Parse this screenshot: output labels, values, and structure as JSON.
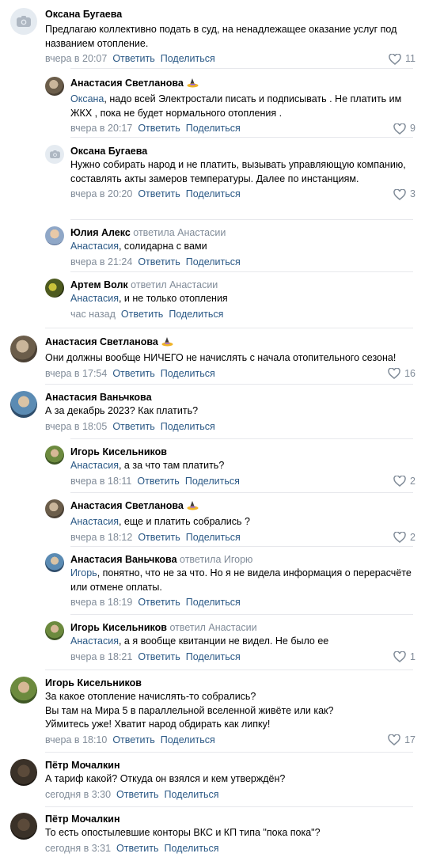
{
  "colors": {
    "link": "#2a5885",
    "meta": "#818c99",
    "separator": "#e7e8ec"
  },
  "labels": {
    "reply": "Ответить",
    "share": "Поделиться"
  },
  "comments": [
    {
      "name": "Оксана Бугаева",
      "avatar": "camera-icon",
      "text": "Предлагаю коллективно подать в суд, на ненадлежащее оказание услуг под названием отопление.",
      "time": "вчера в 20:07",
      "likes": "11"
    },
    {
      "name": "Анастасия Светланова",
      "avatar": "photo",
      "emoji": "witch-hat-emoji",
      "mention": "Оксана",
      "text": ", надо всей Электростали писать и подписывать . Не платить им ЖКХ , пока не будет нормального отопления .",
      "time": "вчера в 20:17",
      "likes": "9"
    },
    {
      "name": "Оксана Бугаева",
      "avatar": "camera-icon",
      "text": "Нужно собирать народ и не платить, вызывать управляющую компанию, составлять акты замеров температуры. Далее по инстанциям.",
      "time": "вчера в 20:20",
      "likes": "3"
    },
    {
      "name": "Юлия Алекс",
      "answered": "ответила Анастасии",
      "avatar": "photo",
      "mention": "Анастасия",
      "text": ", солидарна с вами",
      "time": "вчера в 21:24",
      "likes": ""
    },
    {
      "name": "Артем Волк",
      "answered": "ответил Анастасии",
      "avatar": "photo",
      "mention": "Анастасия",
      "text": ", и не только отопления",
      "time": "час назад",
      "likes": ""
    },
    {
      "name": "Анастасия Светланова",
      "avatar": "photo",
      "emoji": "witch-hat-emoji",
      "text": "Они должны вообще НИЧЕГО не начислять с начала отопительного сезона!",
      "time": "вчера в 17:54",
      "likes": "16"
    },
    {
      "name": "Анастасия Ваньчкова",
      "avatar": "photo",
      "text": "А за декабрь 2023? Как платить?",
      "time": "вчера в 18:05",
      "likes": ""
    },
    {
      "name": "Игорь Кисельников",
      "avatar": "photo",
      "mention": "Анастасия",
      "text": ", а за что там платить?",
      "time": "вчера в 18:11",
      "likes": "2"
    },
    {
      "name": "Анастасия Светланова",
      "avatar": "photo",
      "emoji": "witch-hat-emoji",
      "mention": "Анастасия",
      "text": ", еще и платить собрались ?",
      "time": "вчера в 18:12",
      "likes": "2"
    },
    {
      "name": "Анастасия Ваньчкова",
      "answered": "ответила Игорю",
      "avatar": "photo",
      "mention": "Игорь",
      "text": ", понятно, что не за что. Но я не видела информация о перерасчёте или отмене оплаты.",
      "time": "вчера в 18:19",
      "likes": ""
    },
    {
      "name": "Игорь Кисельников",
      "answered": "ответил Анастасии",
      "avatar": "photo",
      "mention": "Анастасия",
      "text": ", а я вообще квитанции не видел. Не было ее",
      "time": "вчера в 18:21",
      "likes": "1"
    },
    {
      "name": "Игорь Кисельников",
      "avatar": "photo",
      "lines": [
        "За какое отопление начислять-то собрались?",
        "Вы там на Мира 5 в параллельной вселенной живёте или как?",
        "Уймитесь уже! Хватит народ обдирать как липку!"
      ],
      "time": "вчера в 18:10",
      "likes": "17"
    },
    {
      "name": "Пётр Мочалкин",
      "avatar": "photo",
      "text": "А тариф какой? Откуда он взялся и кем утверждён?",
      "time": "сегодня в 3:30",
      "likes": ""
    },
    {
      "name": "Пётр Мочалкин",
      "avatar": "photo",
      "text": "То есть опостылевшие конторы ВКС и КП типа \"пока пока\"?",
      "time": "сегодня в 3:31",
      "likes": ""
    }
  ]
}
